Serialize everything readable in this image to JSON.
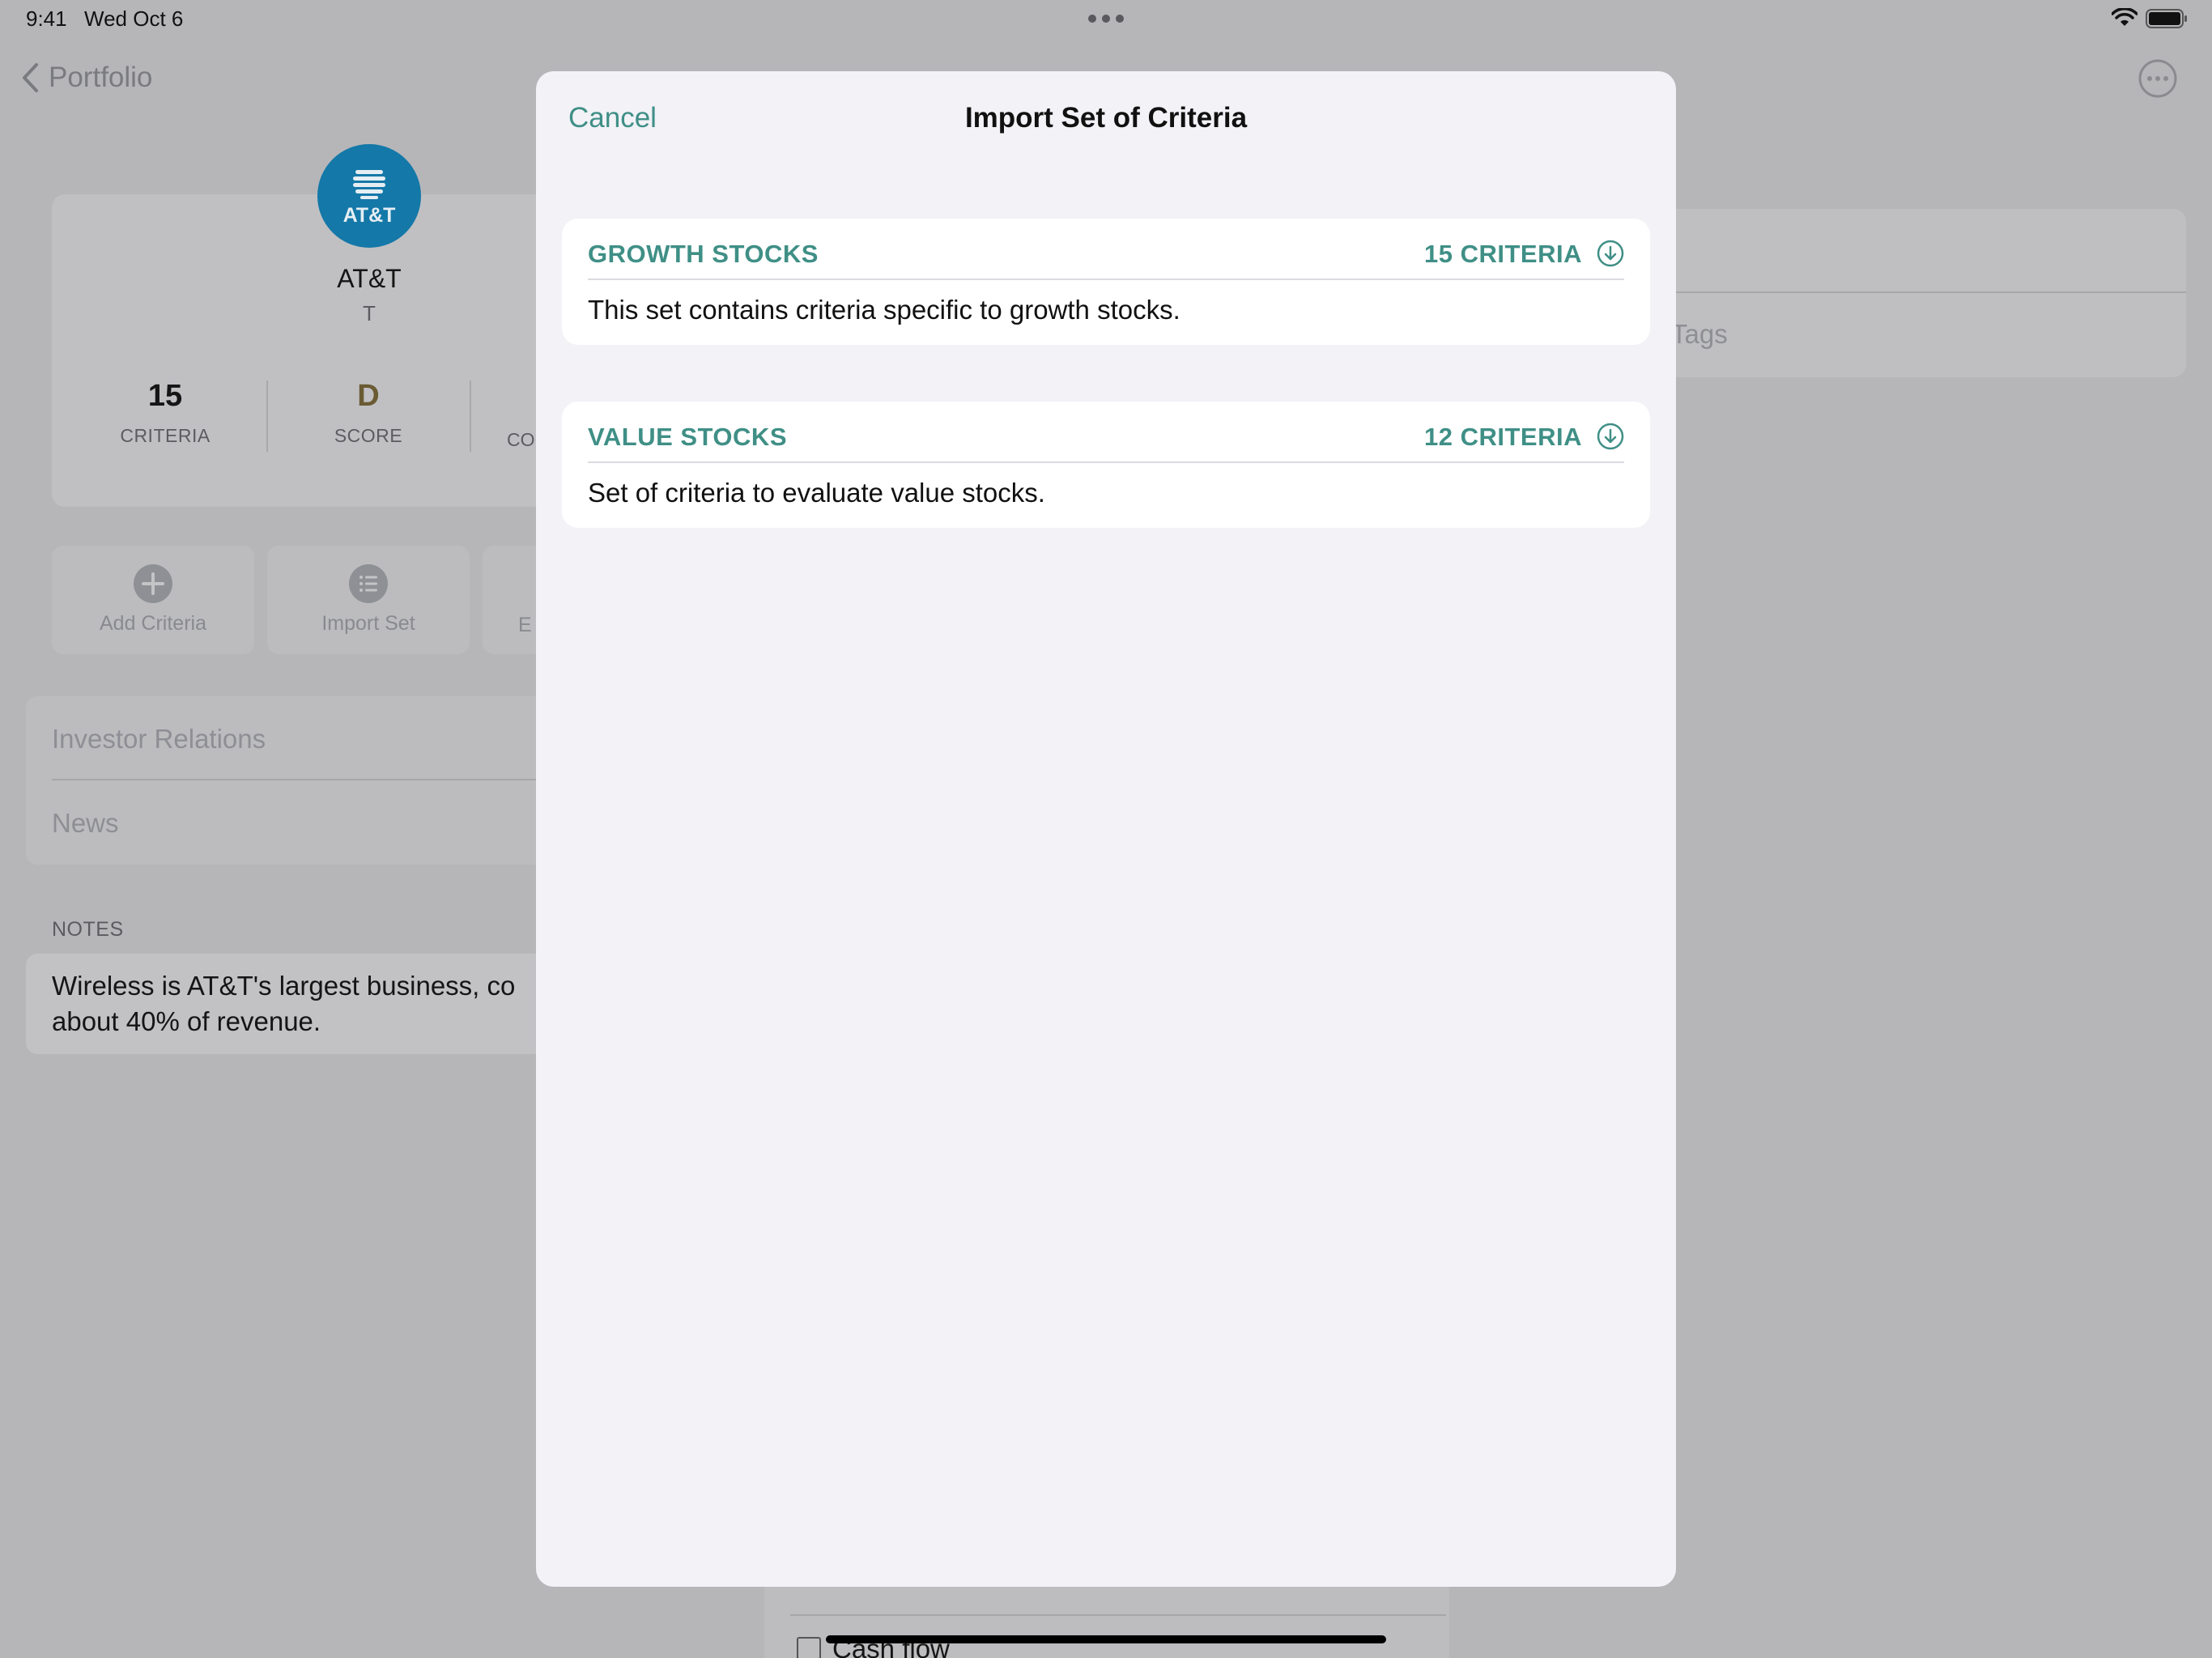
{
  "status_bar": {
    "time": "9:41",
    "date": "Wed Oct 6"
  },
  "background": {
    "nav_back_label": "Portfolio",
    "company": {
      "logo_text": "AT&T",
      "name": "AT&T",
      "ticker": "T"
    },
    "stats": [
      {
        "value": "15",
        "label": "CRITERIA"
      },
      {
        "value": "D",
        "label": "SCORE"
      }
    ],
    "stat_partial_label": "CO",
    "actions": [
      {
        "label": "Add Criteria",
        "icon": "plus-circle-icon"
      },
      {
        "label": "Import Set",
        "icon": "list-circle-icon"
      }
    ],
    "action_partial_label": "E",
    "links": [
      "Investor Relations",
      "News"
    ],
    "notes_label": "NOTES",
    "notes_text": "Wireless is AT&T's largest business, co",
    "notes_text_2": "about 40% of revenue.",
    "right_tags_label": "Tags",
    "bottom_item": "Cash flow"
  },
  "modal": {
    "cancel_label": "Cancel",
    "title": "Import Set of Criteria",
    "sets": [
      {
        "name": "GROWTH STOCKS",
        "count": "15 CRITERIA",
        "description": "This set contains criteria specific to growth stocks."
      },
      {
        "name": "VALUE STOCKS",
        "count": "12 CRITERIA",
        "description": "Set of criteria to evaluate value stocks."
      }
    ]
  },
  "colors": {
    "accent": "#3f8f86",
    "modal_bg": "#f2f2f7",
    "dimmed_bg": "#b6b6b9",
    "att_blue": "#1478a8"
  }
}
